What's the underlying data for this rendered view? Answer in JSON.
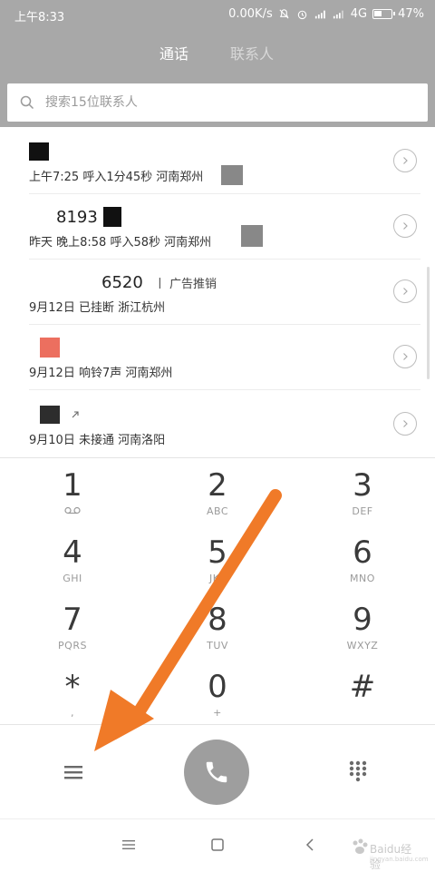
{
  "status": {
    "time": "上午8:33",
    "net_speed": "0.00K/s",
    "network": "4G",
    "battery": "47%"
  },
  "tabs": [
    {
      "label": "通话",
      "active": true
    },
    {
      "label": "联系人",
      "active": false
    }
  ],
  "search": {
    "placeholder": "搜索15位联系人"
  },
  "calls": [
    {
      "name": "",
      "detail": "上午7:25 呼入1分45秒  河南郑州"
    },
    {
      "name": "8193",
      "detail": "昨天 晚上8:58 呼入58秒  河南郑州"
    },
    {
      "name": "6520",
      "tag": "丨 广告推销",
      "detail": "9月12日 已挂断  浙江杭州"
    },
    {
      "name": "",
      "detail": "9月12日 响铃7声  河南郑州"
    },
    {
      "name": "",
      "detail": "9月10日 未接通  河南洛阳"
    }
  ],
  "dialpad": [
    {
      "digit": "1",
      "letters": "voicemail"
    },
    {
      "digit": "2",
      "letters": "ABC"
    },
    {
      "digit": "3",
      "letters": "DEF"
    },
    {
      "digit": "4",
      "letters": "GHI"
    },
    {
      "digit": "5",
      "letters": "JKL"
    },
    {
      "digit": "6",
      "letters": "MNO"
    },
    {
      "digit": "7",
      "letters": "PQRS"
    },
    {
      "digit": "8",
      "letters": "TUV"
    },
    {
      "digit": "9",
      "letters": "WXYZ"
    },
    {
      "digit": "*",
      "letters": ","
    },
    {
      "digit": "0",
      "letters": "+"
    },
    {
      "digit": "#",
      "letters": ""
    }
  ],
  "actions": {
    "menu_icon": "menu-icon",
    "call_icon": "phone-icon",
    "dialpad_icon": "dialpad-grid-icon"
  },
  "watermark": {
    "title": "Baidu经验",
    "sub": "jingyan.baidu.com"
  },
  "colors": {
    "topbar": "#a8a8a8",
    "call_button": "#9e9e9e",
    "annotation_arrow": "#f07a28"
  }
}
